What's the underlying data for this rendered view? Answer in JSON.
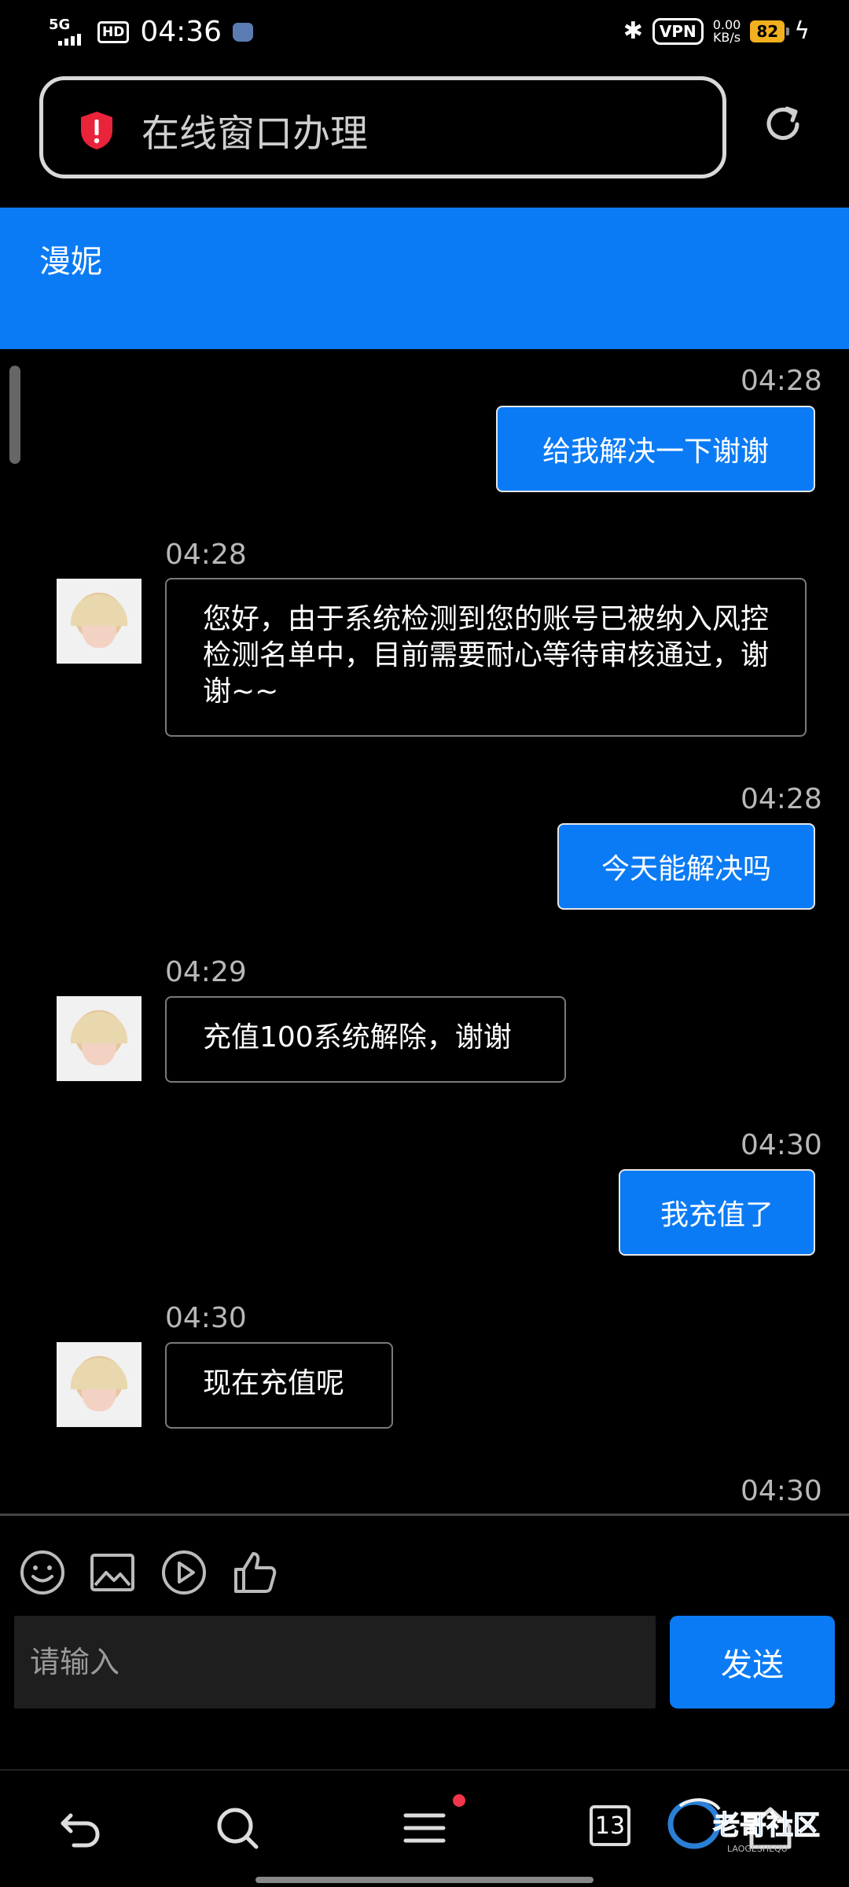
{
  "status_bar": {
    "network": "5G",
    "hd": "HD",
    "time": "04:36",
    "vpn": "VPN",
    "speed_value": "0.00",
    "speed_unit": "KB/s",
    "battery": "82"
  },
  "url_bar": {
    "title": "在线窗口办理"
  },
  "chat": {
    "contact_name": "漫妮",
    "messages": [
      {
        "side": "out",
        "time": "04:28",
        "text": "给我解决一下谢谢"
      },
      {
        "side": "in",
        "time": "04:28",
        "text": "您好，由于系统检测到您的账号已被纳入风控检测名单中，目前需要耐心等待审核通过，谢谢~~"
      },
      {
        "side": "out",
        "time": "04:28",
        "text": "今天能解决吗"
      },
      {
        "side": "in",
        "time": "04:29",
        "text": "充值100系统解除，谢谢"
      },
      {
        "side": "out",
        "time": "04:30",
        "text": "我充值了"
      },
      {
        "side": "in",
        "time": "04:30",
        "text": "现在充值呢"
      },
      {
        "side": "out",
        "time": "04:30",
        "text": ""
      }
    ]
  },
  "composer": {
    "placeholder": "请输入",
    "send_label": "发送",
    "tools": [
      "emoji-icon",
      "image-icon",
      "video-icon",
      "thumbs-up-icon"
    ]
  },
  "bottom_nav": {
    "tabs_count": "13",
    "items": [
      "back-icon",
      "search-icon",
      "menu-icon",
      "tabs-icon",
      "home-icon"
    ]
  },
  "watermark_text": "老哥社区 LAOGESHEQU",
  "colors": {
    "accent": "#0b7bf5",
    "background": "#000000",
    "badge": "#f0364b",
    "battery": "#f2b01e"
  }
}
